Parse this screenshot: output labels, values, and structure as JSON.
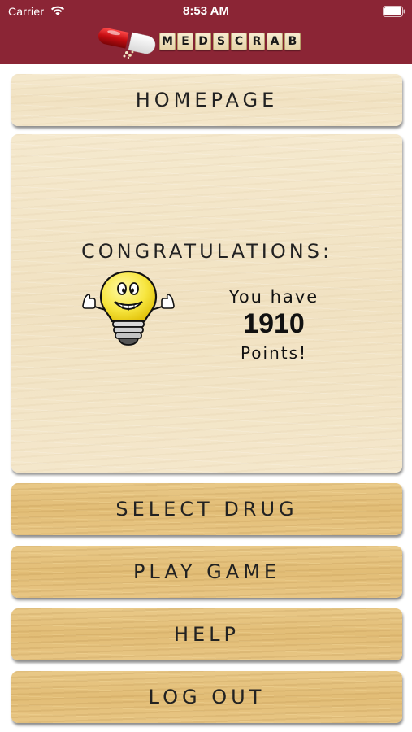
{
  "status_bar": {
    "carrier": "Carrier",
    "time": "8:53 AM"
  },
  "header": {
    "logo_letters": [
      "M",
      "E",
      "D",
      "S",
      "C",
      "R",
      "A",
      "B"
    ],
    "brand_color": "#8b2535"
  },
  "nav": {
    "homepage_label": "HOMEPAGE",
    "select_drug_label": "SELECT DRUG",
    "play_game_label": "PLAY GAME",
    "help_label": "HELP",
    "log_out_label": "LOG OUT"
  },
  "score_card": {
    "heading": "CONGRATULATIONS:",
    "you_have": "You have",
    "points": "1910",
    "points_label": "Points!",
    "icon": "lightbulb-thumbs-up-icon"
  }
}
